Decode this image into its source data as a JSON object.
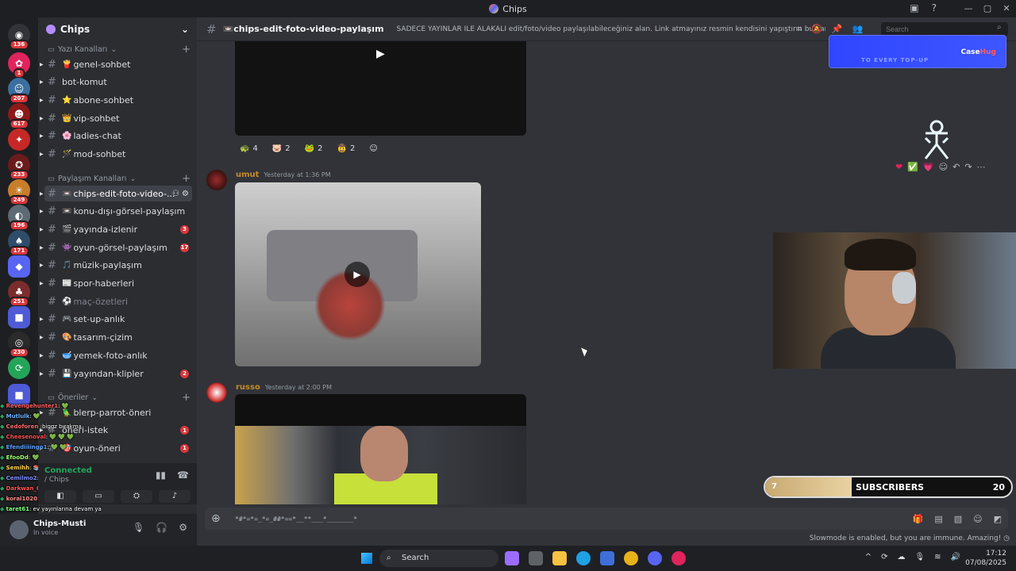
{
  "window": {
    "title": "Chips",
    "controls": [
      "—",
      "▢",
      "✕"
    ],
    "top_icons": [
      "inbox-icon",
      "help-icon"
    ]
  },
  "guilds": [
    {
      "badge": "136",
      "color": "#313338",
      "glyph": "◉"
    },
    {
      "badge": "1",
      "color": "#e0245e",
      "glyph": "✿"
    },
    {
      "badge": "207",
      "color": "#3c6e9f",
      "glyph": "☺"
    },
    {
      "badge": "617",
      "color": "#8b1a1a",
      "glyph": "☻"
    },
    {
      "badge": "",
      "color": "#c62828",
      "glyph": "✦"
    },
    {
      "badge": "233",
      "color": "#6a1b1b",
      "glyph": "✪"
    },
    {
      "badge": "249",
      "color": "#c77d2a",
      "glyph": "☀"
    },
    {
      "badge": "196",
      "color": "#5e6a73",
      "glyph": "◐"
    },
    {
      "badge": "171",
      "color": "#2e4d6b",
      "glyph": "♠"
    },
    {
      "badge": "",
      "color": "#5865f2",
      "glyph": "◆"
    },
    {
      "badge": "251",
      "color": "#7b2d2d",
      "glyph": "♣"
    },
    {
      "badge": "",
      "color": "#4e5bd5",
      "glyph": "■"
    },
    {
      "badge": "230",
      "color": "#2a2a2a",
      "glyph": "◎"
    },
    {
      "badge": "",
      "color": "#23a559",
      "glyph": "⟳"
    },
    {
      "badge": "",
      "color": "#4e5bd5",
      "glyph": "■"
    }
  ],
  "server": {
    "name": "Chips",
    "chevron": "⌄"
  },
  "categories": {
    "text": {
      "label": "Yazı Kanalları"
    },
    "share": {
      "label": "Paylaşım Kanalları"
    },
    "suggest": {
      "label": "Öneriler"
    }
  },
  "channels_text": [
    {
      "emoji": "🍟",
      "name": "genel-sohbet"
    },
    {
      "emoji": "",
      "name": "bot-komut"
    },
    {
      "emoji": "⭐",
      "name": "abone-sohbet"
    },
    {
      "emoji": "👑",
      "name": "vip-sohbet"
    },
    {
      "emoji": "🌸",
      "name": "ladies-chat"
    },
    {
      "emoji": "🪄",
      "name": "mod-sohbet"
    }
  ],
  "channels_share": [
    {
      "emoji": "📼",
      "name": "chips-edit-foto-video-...",
      "badge": "",
      "active": true
    },
    {
      "emoji": "📼",
      "name": "konu-dışı-görsel-paylaşım",
      "badge": ""
    },
    {
      "emoji": "🎬",
      "name": "yayında-izlenir",
      "badge": "3"
    },
    {
      "emoji": "👾",
      "name": "oyun-görsel-paylaşım",
      "badge": "17"
    },
    {
      "emoji": "🎵",
      "name": "müzik-paylaşım",
      "badge": ""
    },
    {
      "emoji": "📰",
      "name": "spor-haberleri",
      "badge": ""
    },
    {
      "emoji": "⚽",
      "name": "maç-özetleri",
      "badge": "",
      "muted": true
    },
    {
      "emoji": "🎮",
      "name": "set-up-anlık",
      "badge": ""
    },
    {
      "emoji": "🎨",
      "name": "tasarım-çizim",
      "badge": ""
    },
    {
      "emoji": "🥣",
      "name": "yemek-foto-anlık",
      "badge": ""
    },
    {
      "emoji": "💾",
      "name": "yayından-klipler",
      "badge": "2"
    }
  ],
  "channels_suggest": [
    {
      "emoji": "🦜",
      "name": "blerp-parrot-öneri",
      "badge": ""
    },
    {
      "emoji": "",
      "name": "öneri-istek",
      "badge": "1"
    },
    {
      "emoji": "🎯",
      "name": "oyun-öneri",
      "badge": "1"
    }
  ],
  "stream_chat": [
    {
      "user": "Revengehunter1",
      "color": "#ff5c5c",
      "text": ": 💚"
    },
    {
      "user": "Mutlulk",
      "color": "#6ab0ff",
      "text": ": 💚"
    },
    {
      "user": "Cedoforen",
      "color": "#ff6b6b",
      "text": " :biggz bırakma"
    },
    {
      "user": "Cheesenoval",
      "color": "#ff4f4f",
      "text": ": 💚 💚 💚"
    },
    {
      "user": "Efendiiiingo1",
      "color": "#5aa0ff",
      "text": ": 💚 💚"
    },
    {
      "user": "EfooDd",
      "color": "#9cff6b",
      "text": ": 💚"
    },
    {
      "user": "Semihh",
      "color": "#ffd34d",
      "text": ": 📚"
    },
    {
      "user": "Cemilmo2",
      "color": "#7c8cff",
      "text": ": 💚"
    },
    {
      "user": "Darkwan_0",
      "color": "#ff5555",
      "text": ": mantıklı"
    },
    {
      "user": "koral1020",
      "color": "#ff8a8a",
      "text": ": 💚"
    },
    {
      "user": "taret61",
      "color": "#7cff7c",
      "text": ": ev yayınlarına devam ya"
    }
  ],
  "voice": {
    "status": "Connected",
    "channel": "/ Chips"
  },
  "user": {
    "name": "Chips-Musti",
    "status": "In voice"
  },
  "channel_header": {
    "name": "📼chips-edit-foto-video-paylaşım",
    "topic": "SADECE YAYINLAR İLE ALAKALI edit/foto/video paylaşılabileceğiniz alan. Link atmayınız resmin kendisini yapıştırın bu kanala lütfen, ...",
    "search_placeholder": "Search"
  },
  "messages": [
    {
      "reactions": [
        {
          "emoji": "🐢",
          "count": "4"
        },
        {
          "emoji": "🐷",
          "count": "2"
        },
        {
          "emoji": "🐸",
          "count": "2"
        },
        {
          "emoji": "🤠",
          "count": "2"
        }
      ]
    },
    {
      "author": "umut",
      "author_color": "#c58b2a",
      "time": "Yesterday at 1:36 PM"
    },
    {
      "author": "russo",
      "author_color": "#c58b2a",
      "time": "Yesterday at 2:00 PM"
    }
  ],
  "hover_actions": [
    "❤",
    "✅",
    "💗",
    "☺",
    "↶",
    "↷",
    "⋯"
  ],
  "composer": {
    "value": "*#*=*=_*=_##*==*__**___*_______*"
  },
  "slowmode": "Slowmode is enabled, but you are immune. Amazing!",
  "ad": {
    "tagline": "TO EVERY TOP-UP",
    "brand_a": "Case",
    "brand_b": "Hug"
  },
  "subs_bar": {
    "current": 7,
    "goal": 20,
    "label": "SUBSCRIBERS",
    "progress": 0.35
  },
  "taskbar": {
    "search": "Search",
    "time": "17:12",
    "date": "07/08/2025"
  }
}
